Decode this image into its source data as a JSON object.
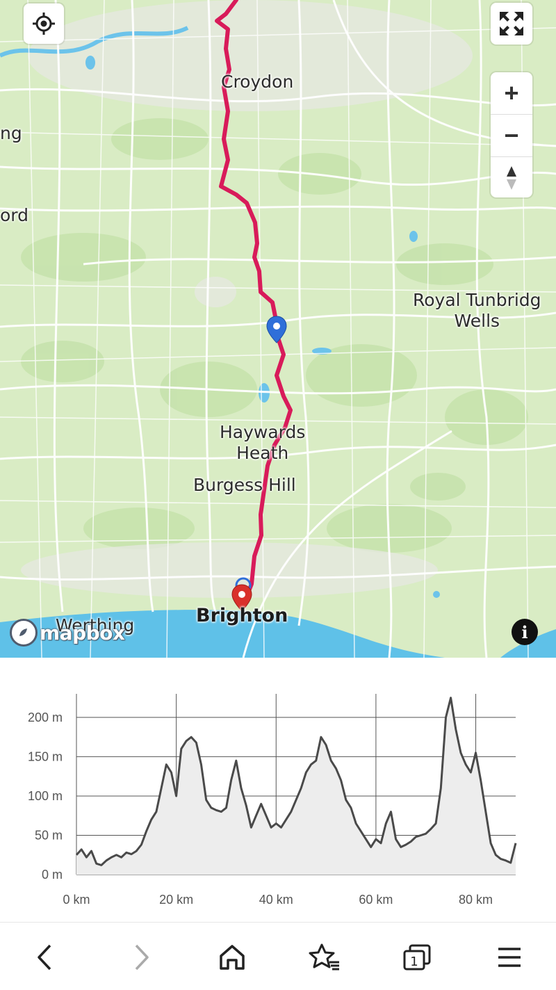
{
  "map": {
    "places": {
      "croydon": "Croydon",
      "partial_left_1": "ng",
      "partial_left_2": "ord",
      "tunbridge": "Royal Tunbridg\nWells",
      "haywards": "Haywards\nHeath",
      "burgess": "Burgess Hill",
      "worthing": "Werthing",
      "brighton": "Brighton"
    },
    "controls": {
      "zoom_in": "+",
      "zoom_out": "−",
      "compass": "▲"
    },
    "attribution": {
      "logo_text": "mapbox",
      "info_icon": "i"
    },
    "colors": {
      "route": "#d81b5a",
      "sea": "#5fc1e8",
      "land": "#d9ecc4",
      "marker_blue": "#2f6fd9",
      "marker_red": "#d9312b"
    }
  },
  "chart_data": {
    "type": "area",
    "title": "",
    "xlabel": "",
    "ylabel": "",
    "x_unit": "km",
    "y_unit": "m",
    "xlim": [
      0,
      88
    ],
    "ylim": [
      0,
      230
    ],
    "x_ticks": [
      "0 km",
      "20 km",
      "40 km",
      "60 km",
      "80 km"
    ],
    "y_ticks": [
      "0 m",
      "50 m",
      "100 m",
      "150 m",
      "200 m"
    ],
    "x": [
      0,
      1,
      2,
      3,
      4,
      5,
      6,
      7,
      8,
      9,
      10,
      11,
      12,
      13,
      14,
      15,
      16,
      17,
      18,
      19,
      20,
      21,
      22,
      23,
      24,
      25,
      26,
      27,
      28,
      29,
      30,
      31,
      32,
      33,
      34,
      35,
      36,
      37,
      38,
      39,
      40,
      41,
      42,
      43,
      44,
      45,
      46,
      47,
      48,
      49,
      50,
      51,
      52,
      53,
      54,
      55,
      56,
      57,
      58,
      59,
      60,
      61,
      62,
      63,
      64,
      65,
      66,
      67,
      68,
      69,
      70,
      71,
      72,
      73,
      74,
      75,
      76,
      77,
      78,
      79,
      80,
      81,
      82,
      83,
      84,
      85,
      86,
      87,
      88
    ],
    "values": [
      25,
      32,
      22,
      30,
      14,
      12,
      18,
      22,
      25,
      22,
      28,
      26,
      30,
      38,
      55,
      70,
      80,
      110,
      140,
      130,
      100,
      160,
      170,
      175,
      168,
      140,
      95,
      85,
      82,
      80,
      85,
      120,
      145,
      110,
      88,
      60,
      75,
      90,
      75,
      60,
      65,
      60,
      70,
      80,
      95,
      110,
      130,
      140,
      145,
      175,
      165,
      145,
      135,
      120,
      95,
      85,
      65,
      55,
      45,
      35,
      45,
      40,
      65,
      80,
      45,
      35,
      38,
      42,
      48,
      50,
      52,
      58,
      65,
      110,
      200,
      225,
      185,
      155,
      140,
      130,
      155,
      120,
      80,
      40,
      25,
      20,
      18,
      15,
      40
    ]
  },
  "bottom_nav": {
    "back_icon": "back-chevron",
    "forward_icon": "forward-chevron",
    "home_icon": "home",
    "bookmarks_icon": "star-list",
    "tabs_count": "1",
    "menu_icon": "hamburger"
  }
}
